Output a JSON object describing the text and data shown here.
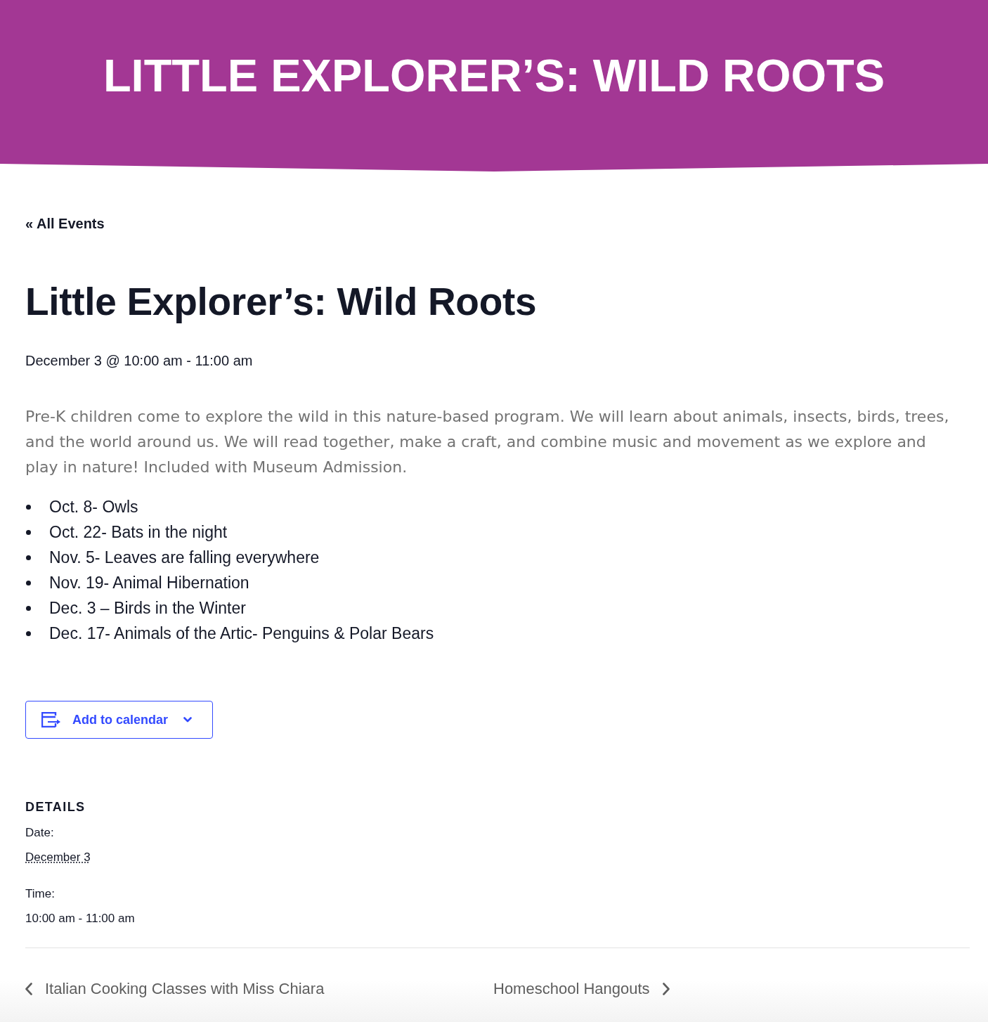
{
  "banner": {
    "title": "LITTLE EXPLORER’S: WILD ROOTS"
  },
  "back_link": "« All Events",
  "event": {
    "title": "Little Explorer’s: Wild Roots",
    "datetime": "December 3 @ 10:00 am - 11:00 am",
    "description": "Pre-K children come to explore the wild in this nature-based program. We will learn about animals, insects, birds, trees, and the world around us. We will read together, make a craft, and combine music and movement as we explore and play in nature! Included with Museum Admission.",
    "schedule": [
      "Oct. 8- Owls",
      "Oct. 22- Bats in the night",
      "Nov. 5- Leaves are falling everywhere",
      "Nov. 19- Animal Hibernation",
      "Dec. 3 – Birds in the Winter",
      "Dec. 17- Animals of the Artic- Penguins & Polar Bears"
    ]
  },
  "calendar_button": {
    "label": "Add to calendar"
  },
  "details": {
    "heading": "DETAILS",
    "fields": [
      {
        "label": "Date:",
        "value": "December 3",
        "kind": "abbr"
      },
      {
        "label": "Time:",
        "value": "10:00 am - 11:00 am",
        "kind": "plain"
      }
    ]
  },
  "event_nav": {
    "previous": "Italian Cooking Classes with Miss Chiara",
    "next": "Homeschool Hangouts"
  }
}
